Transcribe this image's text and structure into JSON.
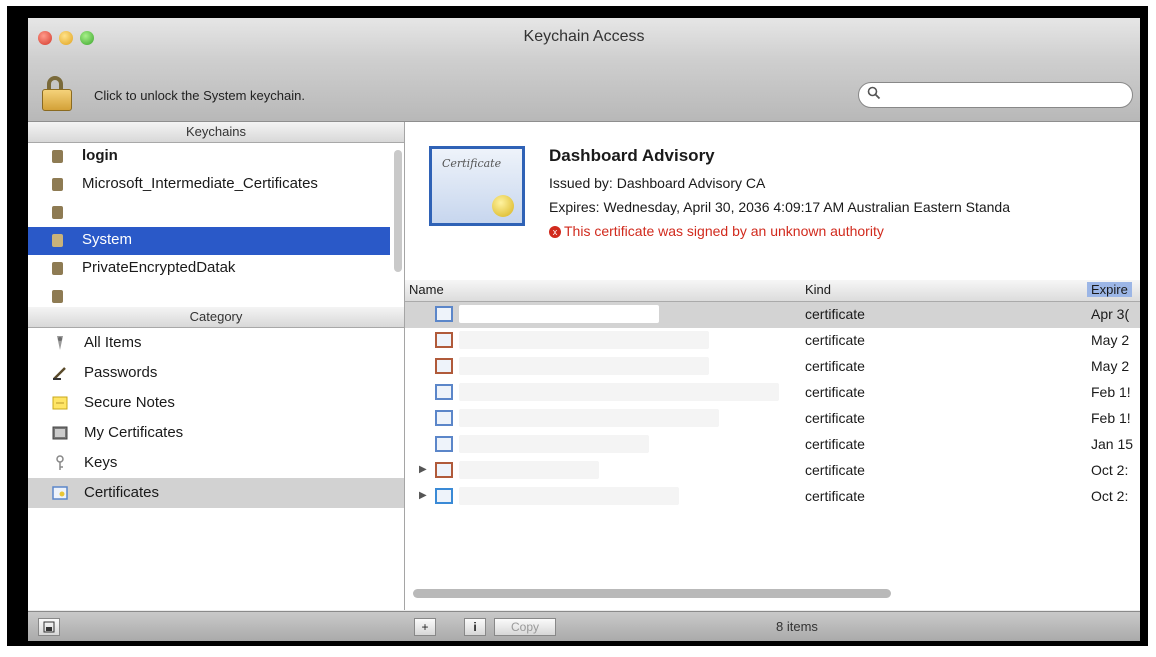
{
  "window": {
    "title": "Keychain Access"
  },
  "toolbar": {
    "unlock_text": "Click to unlock the System keychain.",
    "search_placeholder": ""
  },
  "keychains": {
    "header": "Keychains",
    "items": [
      {
        "label": "login"
      },
      {
        "label": "Microsoft_Intermediate_Certificates"
      },
      {
        "label": ""
      },
      {
        "label": "System",
        "selected": true
      },
      {
        "label": "PrivateEncryptedDatak"
      }
    ]
  },
  "category": {
    "header": "Category",
    "items": [
      {
        "label": "All Items",
        "icon": "all-items-icon"
      },
      {
        "label": "Passwords",
        "icon": "passwords-icon"
      },
      {
        "label": "Secure Notes",
        "icon": "secure-notes-icon"
      },
      {
        "label": "My Certificates",
        "icon": "my-certificates-icon"
      },
      {
        "label": "Keys",
        "icon": "key-icon"
      },
      {
        "label": "Certificates",
        "icon": "certificates-icon",
        "selected": true
      }
    ]
  },
  "cert": {
    "name": "Dashboard Advisory",
    "issued_by": "Issued by: Dashboard Advisory CA",
    "expires": "Expires: Wednesday, April 30, 2036 4:09:17 AM Australian Eastern Standa",
    "warning": "This certificate was signed by an unknown authority",
    "image_text": "Certificate"
  },
  "table": {
    "columns": {
      "name": "Name",
      "kind": "Kind",
      "expires": "Expire"
    },
    "rows": [
      {
        "kind": "certificate",
        "expires": "Apr 3(",
        "icon": "certificate-icon",
        "selected": true
      },
      {
        "kind": "certificate",
        "expires": "May 2",
        "icon": "certificate-error-icon"
      },
      {
        "kind": "certificate",
        "expires": "May 2",
        "icon": "certificate-error-icon"
      },
      {
        "kind": "certificate",
        "expires": "Feb 1!",
        "icon": "certificate-icon"
      },
      {
        "kind": "certificate",
        "expires": "Feb 1!",
        "icon": "certificate-icon"
      },
      {
        "kind": "certificate",
        "expires": "Jan 15",
        "icon": "certificate-icon"
      },
      {
        "kind": "certificate",
        "expires": "Oct 2:",
        "icon": "certificate-error-icon"
      },
      {
        "kind": "certificate",
        "expires": "Oct 2:",
        "icon": "certificate-root-icon"
      }
    ]
  },
  "bottombar": {
    "add_label": "+",
    "info_label": "i",
    "copy_label": "Copy",
    "count": "8 items"
  },
  "colors": {
    "selection": "#2a59c8",
    "warning": "#d12a1d"
  }
}
